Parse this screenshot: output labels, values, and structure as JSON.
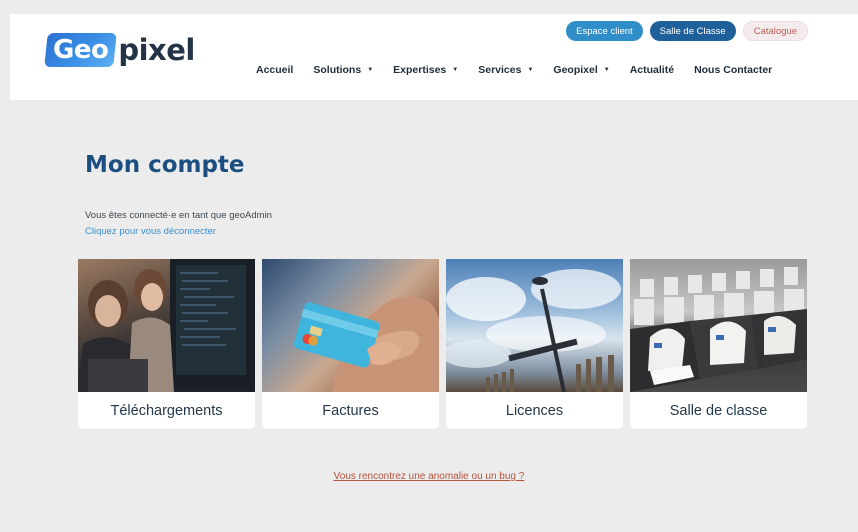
{
  "header": {
    "logo": {
      "part1": "Geo",
      "part2": "pixel"
    },
    "top_buttons": {
      "client": "Espace client",
      "classe": "Salle de Classe",
      "catalogue": "Catalogue"
    },
    "nav": [
      {
        "label": "Accueil",
        "caret": false
      },
      {
        "label": "Solutions",
        "caret": true
      },
      {
        "label": "Expertises",
        "caret": true
      },
      {
        "label": "Services",
        "caret": true
      },
      {
        "label": "Geopixel",
        "caret": true
      },
      {
        "label": "Actualité",
        "caret": false
      },
      {
        "label": "Nous Contacter",
        "caret": false
      }
    ]
  },
  "main": {
    "title": "Mon compte",
    "connected_text": "Vous êtes connecté·e en tant que geoAdmin",
    "logout_link": "Cliquez pour vous déconnecter",
    "cards": [
      {
        "label": "Téléchargements",
        "image": "office-photo"
      },
      {
        "label": "Factures",
        "image": "credit-card-photo"
      },
      {
        "label": "Licences",
        "image": "sky-pole-photo"
      },
      {
        "label": "Salle de classe",
        "image": "classroom-photo"
      }
    ],
    "bug_link": "Vous rencontrez une anomalie ou un bug ?"
  },
  "colors": {
    "primary": "#1c4f80",
    "client_btn": "#2f8ec8",
    "classe_btn": "#1f5f9a",
    "link": "#3a8fd0",
    "bug_link": "#b5543c",
    "background": "#ececec"
  }
}
